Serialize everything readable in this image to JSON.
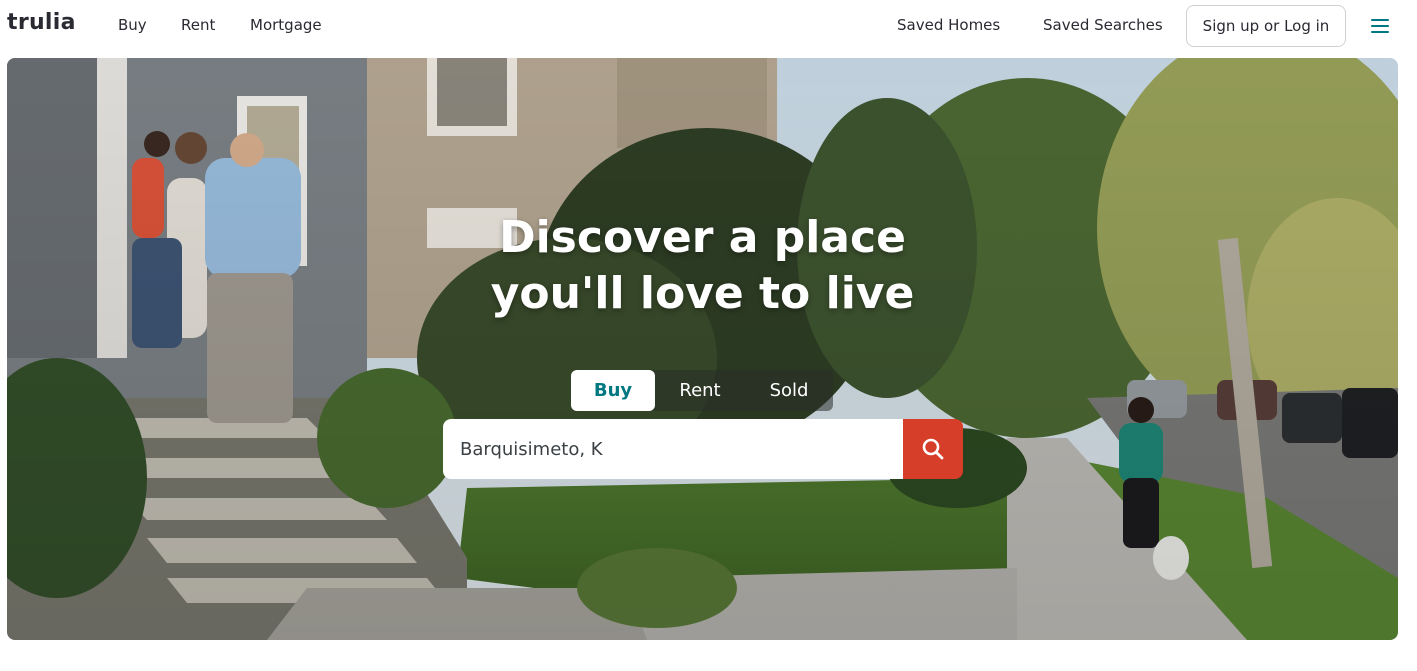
{
  "header": {
    "logo": "trulia",
    "nav_left": [
      "Buy",
      "Rent",
      "Mortgage"
    ],
    "saved_homes": "Saved Homes",
    "saved_searches": "Saved Searches",
    "signup_label": "Sign up or Log in",
    "menu_icon": "hamburger-menu-icon"
  },
  "hero": {
    "title_line1": "Discover a place",
    "title_line2": "you'll love to live",
    "tabs": [
      "Buy",
      "Rent",
      "Sold"
    ],
    "active_tab": "Buy",
    "search_value": "Barquisimeto, K",
    "search_icon": "search-icon"
  },
  "colors": {
    "brand_teal": "#007882",
    "search_button": "#d63e2a",
    "text": "#2a2a33"
  }
}
